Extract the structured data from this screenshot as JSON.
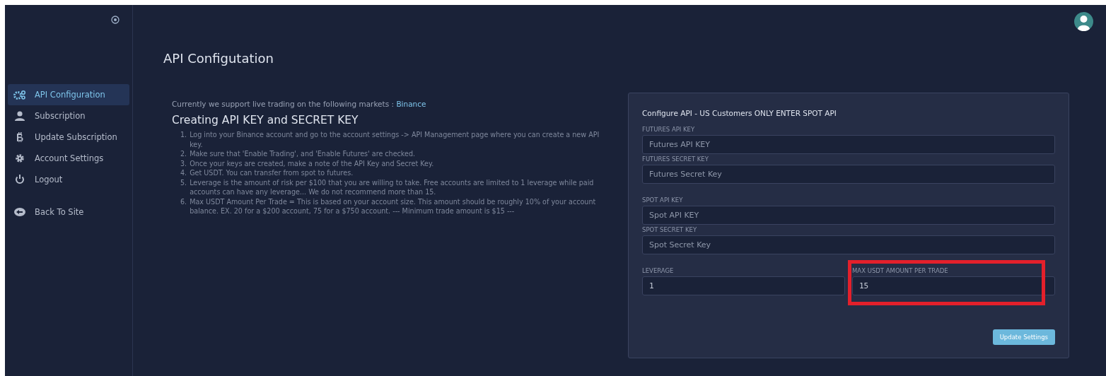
{
  "sidebar": {
    "items": [
      {
        "label": "API Configuration",
        "selected": true
      },
      {
        "label": "Subscription",
        "selected": false
      },
      {
        "label": "Update Subscription",
        "selected": false
      },
      {
        "label": "Account Settings",
        "selected": false
      },
      {
        "label": "Logout",
        "selected": false
      },
      {
        "label": "Back To Site",
        "selected": false
      }
    ]
  },
  "page_title": "API Configutation",
  "intro": {
    "text": "Currently we support live trading on the following markets :",
    "link": "Binance"
  },
  "guide": {
    "heading": "Creating API KEY and SECRET KEY",
    "steps": [
      {
        "number": "1.",
        "text": "Log into your Binance account and go to the account settings -> API Management page where you can create a new API key."
      },
      {
        "number": "2.",
        "text": "Make sure that 'Enable Trading', and 'Enable Futures' are checked."
      },
      {
        "number": "3.",
        "text": "Once your keys are created, make a note of the API Key and Secret Key."
      },
      {
        "number": "4.",
        "text": "Get USDT. You can transfer from spot to futures."
      },
      {
        "number": "5.",
        "text": "Leverage is the amount of risk per $100 that you are willing to take. Free accounts are limited to 1 leverage while paid accounts can have any leverage... We do not recommend more than 15."
      },
      {
        "number": "6.",
        "text": "Max USDT Amount Per Trade = This is based on your account size. This amount should be roughly 10% of your account balance. EX. 20 for a $200 account, 75 for a $750 account. --- Minimum trade amount is $15 ---"
      }
    ]
  },
  "form": {
    "title": "Configure API - US Customers ONLY ENTER SPOT API",
    "rows": [
      [
        {
          "label": "FUTURES API KEY",
          "placeholder": "Futures API KEY",
          "highlighted": false
        }
      ],
      [
        {
          "label": "FUTURES SECRET KEY",
          "placeholder": "Futures Secret Key",
          "highlighted": false
        }
      ],
      [
        {
          "label": "SPOT API KEY",
          "placeholder": "Spot API KEY",
          "highlighted": false
        }
      ],
      [
        {
          "label": "SPOT SECRET KEY",
          "placeholder": "Spot Secret Key",
          "highlighted": false
        }
      ],
      [
        {
          "label": "LEVERAGE",
          "value": "1",
          "highlighted": false
        },
        {
          "label": "MAX USDT AMOUNT PER TRADE",
          "value": "15",
          "highlighted": true
        }
      ]
    ],
    "button": "Update Settings"
  }
}
